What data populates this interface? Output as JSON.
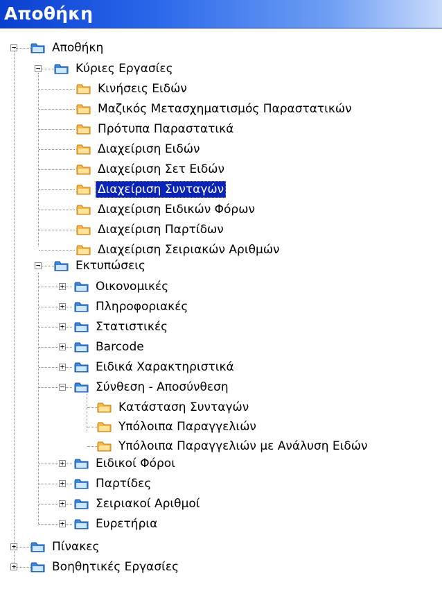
{
  "window": {
    "title": "Αποθήκη"
  },
  "colors": {
    "title_bar": "#2a68ea",
    "selection": "#0a24b8",
    "folder_blue": "#3b86d8",
    "folder_yellow": "#f7b84a"
  },
  "tree": {
    "root": {
      "label": "Αποθήκη",
      "icon": "folder-blue-icon",
      "expanded": true
    },
    "main_tasks": {
      "label": "Κύριες Εργασίες",
      "icon": "folder-blue-icon",
      "expanded": true,
      "items": [
        "Κινήσεις Ειδών",
        "Μαζικός Μετασχηματισμός Παραστατικών",
        "Πρότυπα Παραστατικά",
        "Διαχείριση Ειδών",
        "Διαχείριση Σετ Ειδών",
        "Διαχείριση Συνταγών",
        "Διαχείριση Ειδικών Φόρων",
        "Διαχείριση Παρτίδων",
        "Διαχείριση Σειριακών Αριθμών"
      ],
      "selected_index": 5
    },
    "reports": {
      "label": "Εκτυπώσεις",
      "icon": "folder-blue-icon",
      "expanded": true,
      "groups": [
        "Οικονομικές",
        "Πληροφοριακές",
        "Στατιστικές",
        "Barcode",
        "Ειδικά Χαρακτηριστικά",
        "Σύνθεση - Αποσύνθεση",
        "Ειδικοί Φόροι",
        "Παρτίδες",
        "Σειριακοί Αριθμοί",
        "Ευρετήρια"
      ],
      "synthesis_items": [
        "Κατάσταση Συνταγών",
        "Υπόλοιπα Παραγγελιών",
        "Υπόλοιπα Παραγγελιών με Ανάλυση Ειδών"
      ]
    },
    "tables": {
      "label": "Πίνακες",
      "icon": "folder-blue-icon",
      "expanded": false
    },
    "helper_tasks": {
      "label": "Βοηθητικές Εργασίες",
      "icon": "folder-blue-icon",
      "expanded": false
    }
  }
}
